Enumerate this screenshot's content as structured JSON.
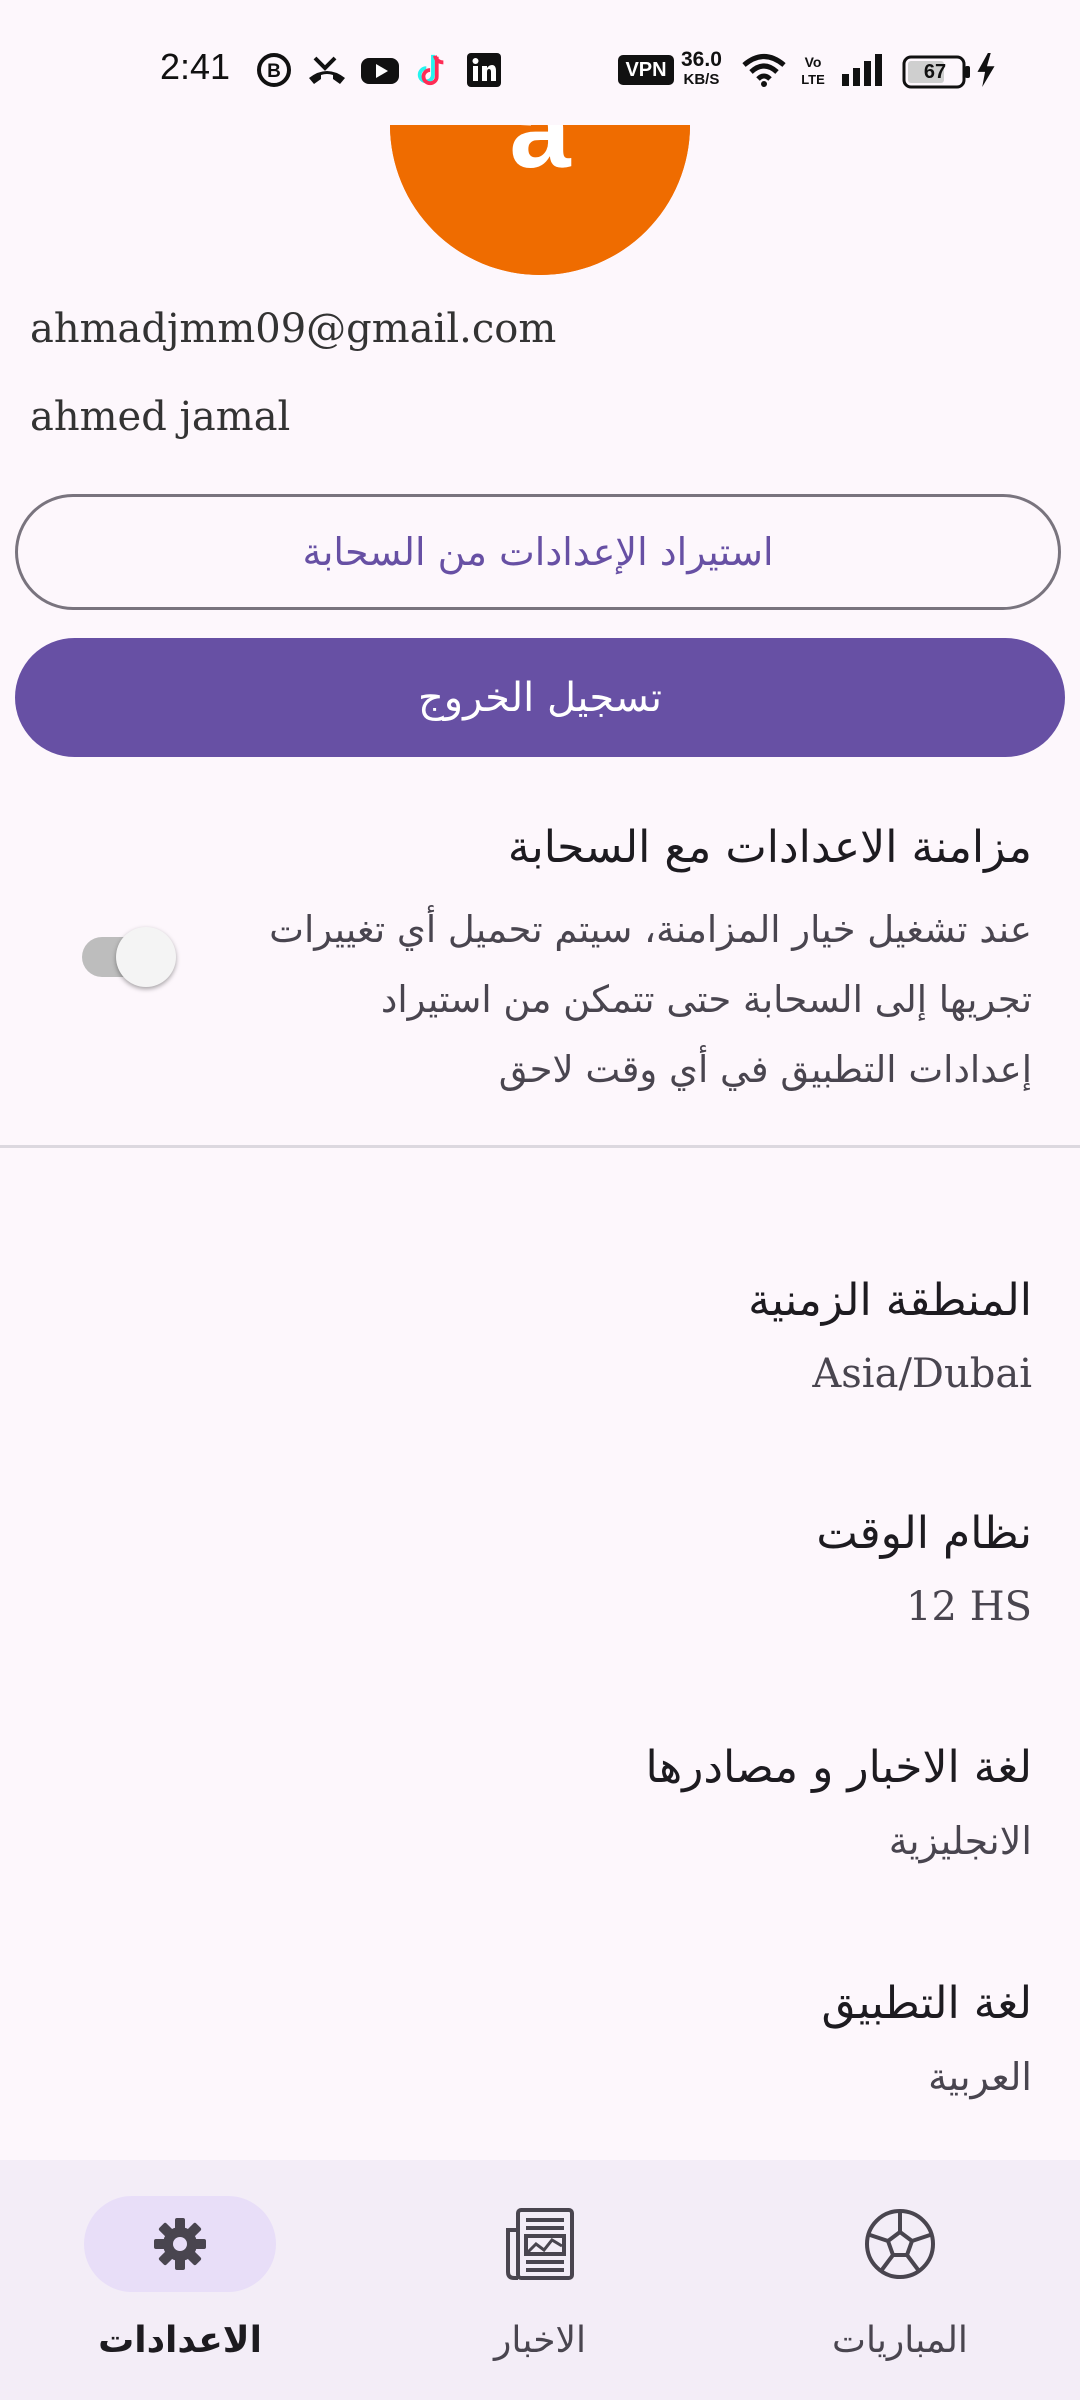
{
  "status_bar": {
    "time": "2:41",
    "vpn_label": "VPN",
    "net_speed_value": "36.0",
    "net_speed_unit": "KB/S",
    "volte_label": "Vo LTE",
    "battery_level": "67",
    "icons": [
      "b-circle-icon",
      "missed-call-icon",
      "youtube-icon",
      "tiktok-icon",
      "linkedin-icon",
      "vpn-icon",
      "wifi-icon",
      "volte-icon",
      "signal-icon",
      "battery-icon",
      "charging-icon"
    ]
  },
  "profile": {
    "avatar_letter": "a",
    "avatar_color": "#ef6c00",
    "email": "ahmadjmm09@gmail.com",
    "name": "ahmed jamal"
  },
  "actions": {
    "restore_label": "استيراد الإعدادات من السحابة",
    "logout_label": "تسجيل الخروج"
  },
  "sync": {
    "title": "مزامنة الاعدادات مع السحابة",
    "description": "عند تشغيل خيار المزامنة، سيتم تحميل أي تغييرات تجريها إلى السحابة حتى تتمكن من استيراد إعدادات التطبيق في أي وقت لاحق",
    "enabled": false
  },
  "settings": [
    {
      "title": "المنطقة الزمنية",
      "value": "Asia/Dubai"
    },
    {
      "title": "نظام الوقت",
      "value": "12 HS"
    },
    {
      "title": "لغة الاخبار و مصادرها",
      "value": "الانجليزية"
    },
    {
      "title": "لغة التطبيق",
      "value": "العربية"
    }
  ],
  "bottom_nav": {
    "items": [
      {
        "label": "الاعدادات",
        "icon": "gear-icon",
        "active": true
      },
      {
        "label": "الاخبار",
        "icon": "newspaper-icon",
        "active": false
      },
      {
        "label": "المباريات",
        "icon": "soccer-ball-icon",
        "active": false
      }
    ]
  },
  "colors": {
    "primary": "#6750a4",
    "background": "#fdf7fc",
    "nav_background": "#f3edf7",
    "nav_active_pill": "#e8def8",
    "avatar": "#ef6c00"
  }
}
